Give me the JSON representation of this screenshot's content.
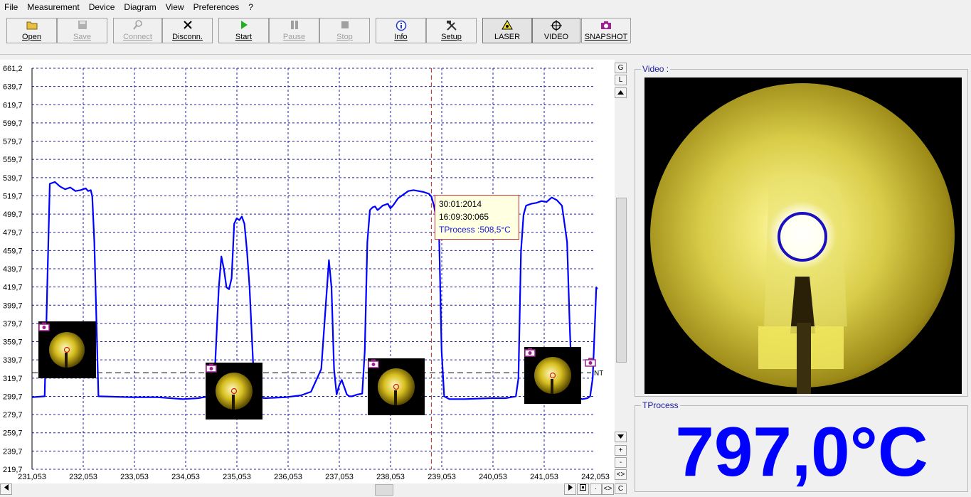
{
  "menu": [
    "File",
    "Measurement",
    "Device",
    "Diagram",
    "View",
    "Preferences",
    "?"
  ],
  "toolbar": {
    "open": "Open",
    "save": "Save",
    "connect": "Connect",
    "disconnect": "Disconn.",
    "start": "Start",
    "pause": "Pause",
    "stop": "Stop",
    "info": "Info",
    "setup": "Setup",
    "laser": "LASER",
    "video": "VIDEO",
    "snapshot": "SNAPSHOT"
  },
  "scroll_letters": {
    "g": "G",
    "l": "L",
    "plus": "+",
    "minus": "-",
    "zoom": "<>",
    "c": "C",
    "hzoom": "<>",
    "hdot": "·"
  },
  "tooltip": {
    "date": "30:01:2014",
    "time": "16:09:30:065",
    "value": "TProcess :508,5°C"
  },
  "video_panel": {
    "title": "Video :"
  },
  "tprocess_panel": {
    "title": "TProcess",
    "value": "797,0°C"
  },
  "line_marker_label": "NT",
  "colors": {
    "series": "#0000ff",
    "grid": "#2020a0",
    "cursor": "#c02020",
    "threshold": "#000000",
    "big_value": "#0000ff"
  },
  "chart_data": {
    "type": "line",
    "xlim": [
      231.053,
      242.053
    ],
    "ylim": [
      219.7,
      661.2
    ],
    "y_ticks": [
      "661,2",
      "639,7",
      "619,7",
      "599,7",
      "579,7",
      "559,7",
      "539,7",
      "519,7",
      "499,7",
      "479,7",
      "459,7",
      "439,7",
      "419,7",
      "399,7",
      "379,7",
      "359,7",
      "339,7",
      "319,7",
      "299,7",
      "279,7",
      "259,7",
      "239,7",
      "219,7"
    ],
    "x_ticks": [
      "231,053",
      "232,053",
      "233,053",
      "234,053",
      "235,053",
      "236,053",
      "237,053",
      "238,053",
      "239,053",
      "240,053",
      "241,053",
      "242,053"
    ],
    "x_tick_values": [
      231.053,
      232.053,
      233.053,
      234.053,
      235.053,
      236.053,
      237.053,
      238.053,
      239.053,
      240.053,
      241.053,
      242.053
    ],
    "cursor_x": 238.85,
    "threshold_y": 326,
    "series": [
      {
        "x": [
          231.053,
          231.3,
          231.35,
          231.4,
          231.5,
          231.6,
          231.7,
          231.8,
          231.9,
          232.0,
          232.1,
          232.15,
          232.2,
          232.23,
          232.27,
          232.35,
          233.0,
          233.5,
          234.0,
          234.3,
          234.5,
          234.6,
          234.7,
          234.75,
          234.8,
          234.85,
          234.9,
          234.95,
          235.0,
          235.05,
          235.1,
          235.15,
          235.2,
          235.25,
          235.3,
          235.4,
          235.6,
          236.0,
          236.3,
          236.5,
          236.7,
          236.8,
          236.85,
          236.9,
          236.95,
          237.0,
          237.05,
          237.1,
          237.15,
          237.2,
          237.25,
          237.3,
          237.4,
          237.5,
          237.55,
          237.6,
          237.65,
          237.7,
          237.75,
          237.8,
          237.9,
          238.0,
          238.05,
          238.1,
          238.2,
          238.3,
          238.4,
          238.5,
          238.6,
          238.7,
          238.75,
          238.8,
          238.85,
          238.9,
          239.0,
          239.05,
          239.1,
          239.2,
          239.3,
          239.5,
          240.0,
          240.3,
          240.5,
          240.55,
          240.6,
          240.65,
          240.7,
          240.8,
          240.9,
          241.0,
          241.1,
          241.2,
          241.3,
          241.4,
          241.5,
          241.55,
          241.6,
          241.65,
          241.7,
          241.8,
          241.9,
          241.95,
          242.0,
          242.05,
          242.07,
          242.09
        ],
        "y": [
          299,
          300,
          420,
          534,
          536,
          531,
          528,
          530,
          526,
          527,
          529,
          526,
          527,
          520,
          470,
          300,
          299,
          299,
          297,
          298,
          300,
          301,
          420,
          454,
          440,
          420,
          418,
          430,
          490,
          496,
          494,
          498,
          490,
          460,
          420,
          300,
          298,
          299,
          301,
          305,
          330,
          410,
          450,
          420,
          330,
          302,
          312,
          318,
          310,
          302,
          300,
          300,
          302,
          303,
          350,
          470,
          505,
          508,
          509,
          505,
          510,
          512,
          507,
          510,
          518,
          522,
          526,
          527,
          526,
          525,
          524,
          523,
          520,
          510,
          480,
          350,
          300,
          297,
          297,
          297,
          298,
          298,
          300,
          320,
          460,
          500,
          510,
          512,
          513,
          515,
          514,
          519,
          516,
          510,
          470,
          380,
          305,
          299,
          298,
          297,
          298,
          300,
          320,
          390,
          420,
          418
        ]
      }
    ]
  }
}
